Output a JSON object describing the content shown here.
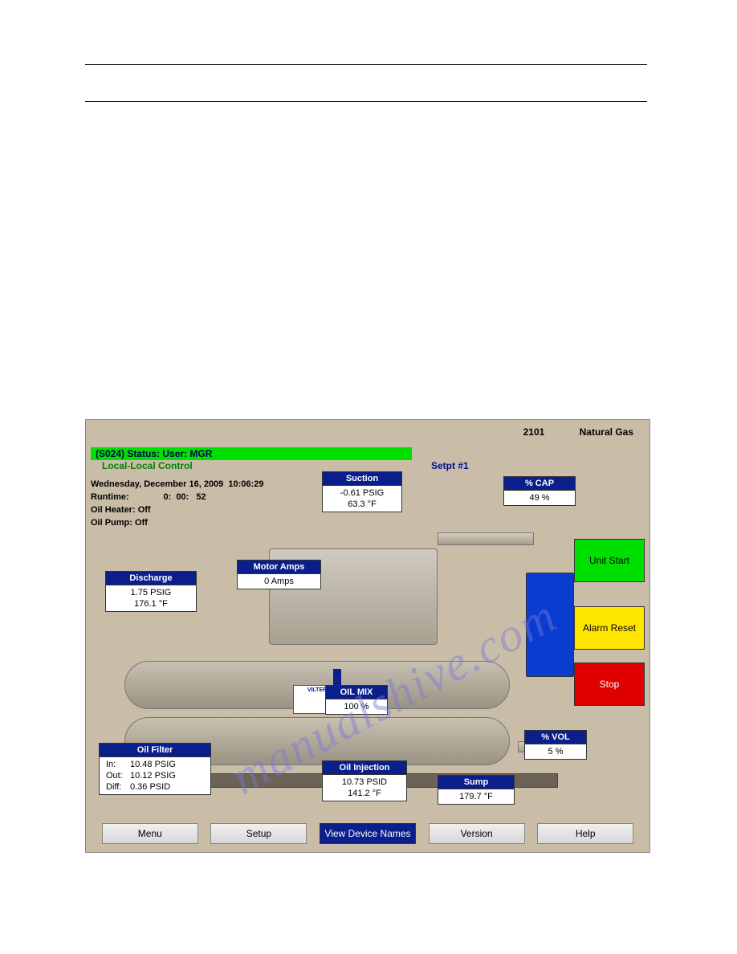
{
  "header": {
    "unit": "2101",
    "gas": "Natural Gas"
  },
  "status": {
    "line": "(S024) Status: User: MGR",
    "control": "Local-Local Control",
    "setpoint": "Setpt #1"
  },
  "info": {
    "datetime": "Wednesday, December 16, 2009  10:06:29",
    "runtime_label": "Runtime:",
    "runtime_value": "0:  00:   52",
    "oil_heater_label": "Oil Heater:",
    "oil_heater_value": "Off",
    "oil_pump_label": "Oil Pump:",
    "oil_pump_value": "Off"
  },
  "gauges": {
    "suction": {
      "title": "Suction",
      "line1": "-0.61 PSIG",
      "line2": "63.3 °F"
    },
    "cap": {
      "title": "% CAP",
      "line1": "49 %"
    },
    "motor": {
      "title": "Motor Amps",
      "line1": "0 Amps"
    },
    "discharge": {
      "title": "Discharge",
      "line1": "1.75 PSIG",
      "line2": "176.1 °F"
    },
    "oilmix": {
      "title": "OIL MIX",
      "line1": "100 %"
    },
    "vol": {
      "title": "% VOL",
      "line1": "5 %"
    },
    "oilinj": {
      "title": "Oil Injection",
      "line1": "10.73 PSID",
      "line2": "141.2 °F"
    },
    "sump": {
      "title": "Sump",
      "line1": "179.7 °F"
    },
    "oilfilter": {
      "title": "Oil Filter",
      "in_label": "In:",
      "in_value": "10.48 PSIG",
      "out_label": "Out:",
      "out_value": "10.12 PSIG",
      "diff_label": "Diff:",
      "diff_value": "0.36 PSID"
    }
  },
  "actions": {
    "start": "Unit Start",
    "alarm": "Alarm Reset",
    "stop": "Stop"
  },
  "nav": {
    "menu": "Menu",
    "setup": "Setup",
    "view": "View Device Names",
    "version": "Version",
    "help": "Help"
  },
  "machine": {
    "brand": "VILTER"
  },
  "watermark": "manualshive.com"
}
